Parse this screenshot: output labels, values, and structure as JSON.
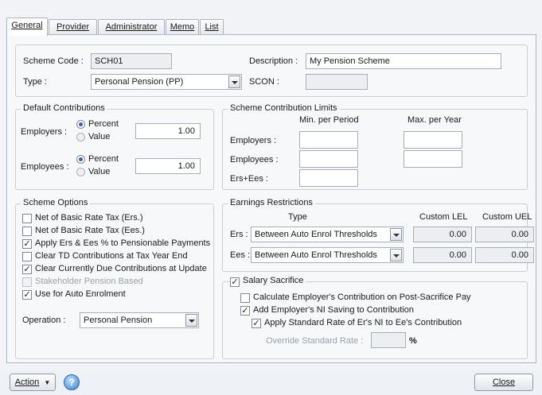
{
  "tabs": [
    {
      "label": "General",
      "active": true
    },
    {
      "label": "Provider",
      "active": false
    },
    {
      "label": "Administrator",
      "active": false
    },
    {
      "label": "Memo",
      "active": false
    },
    {
      "label": "List",
      "active": false
    }
  ],
  "scheme": {
    "code_label": "Scheme Code :",
    "code_value": "SCH01",
    "description_label": "Description :",
    "description_value": "My Pension Scheme",
    "type_label": "Type :",
    "type_value": "Personal Pension (PP)",
    "scon_label": "SCON :",
    "scon_value": ""
  },
  "default_contributions": {
    "title": "Default Contributions",
    "employers_label": "Employers :",
    "employees_label": "Employees :",
    "percent_label": "Percent",
    "value_label": "Value",
    "employers_value": "1.00",
    "employees_value": "1.00"
  },
  "limits": {
    "title": "Scheme Contribution Limits",
    "min_header": "Min. per Period",
    "max_header": "Max. per Year",
    "employers_label": "Employers :",
    "employees_label": "Employees :",
    "ers_ees_label": "Ers+Ees :"
  },
  "options": {
    "title": "Scheme Options",
    "items": [
      {
        "label": "Net of Basic Rate Tax (Ers.)",
        "checked": false,
        "disabled": false
      },
      {
        "label": "Net of Basic Rate Tax (Ees.)",
        "checked": false,
        "disabled": false
      },
      {
        "label": "Apply Ers & Ees % to Pensionable Payments",
        "checked": true,
        "disabled": false
      },
      {
        "label": "Clear TD Contributions at Tax Year End",
        "checked": false,
        "disabled": false
      },
      {
        "label": "Clear Currently Due Contributions at Update",
        "checked": true,
        "disabled": false
      },
      {
        "label": "Stakeholder Pension Based",
        "checked": false,
        "disabled": true
      },
      {
        "label": "Use for Auto Enrolment",
        "checked": true,
        "disabled": false
      }
    ],
    "operation_label": "Operation :",
    "operation_value": "Personal Pension"
  },
  "earnings": {
    "title": "Earnings Restrictions",
    "type_header": "Type",
    "lel_header": "Custom LEL",
    "uel_header": "Custom UEL",
    "ers_label": "Ers :",
    "ees_label": "Ees :",
    "ers_type": "Between Auto Enrol Thresholds",
    "ees_type": "Between Auto Enrol Thresholds",
    "ers_lel": "0.00",
    "ers_uel": "0.00",
    "ees_lel": "0.00",
    "ees_uel": "0.00"
  },
  "salary_sacrifice": {
    "label": "Salary Sacrifice",
    "calc_label": "Calculate Employer's Contribution on Post-Sacrifice Pay",
    "add_ni_label": "Add Employer's NI Saving to Contribution",
    "apply_rate_label": "Apply Standard Rate of Er's NI to Ee's Contribution",
    "override_label": "Override Standard Rate :",
    "override_value": "",
    "percent_sign": "%"
  },
  "footer": {
    "action_label": "Action",
    "close_label": "Close"
  },
  "icons": {
    "help": "help-question-icon",
    "dropdown": "chevron-down-icon",
    "check": "checkmark-icon"
  },
  "colors": {
    "accent": "#3b5ea8",
    "panel": "#f7f8fa",
    "border": "#a9b3c2"
  }
}
